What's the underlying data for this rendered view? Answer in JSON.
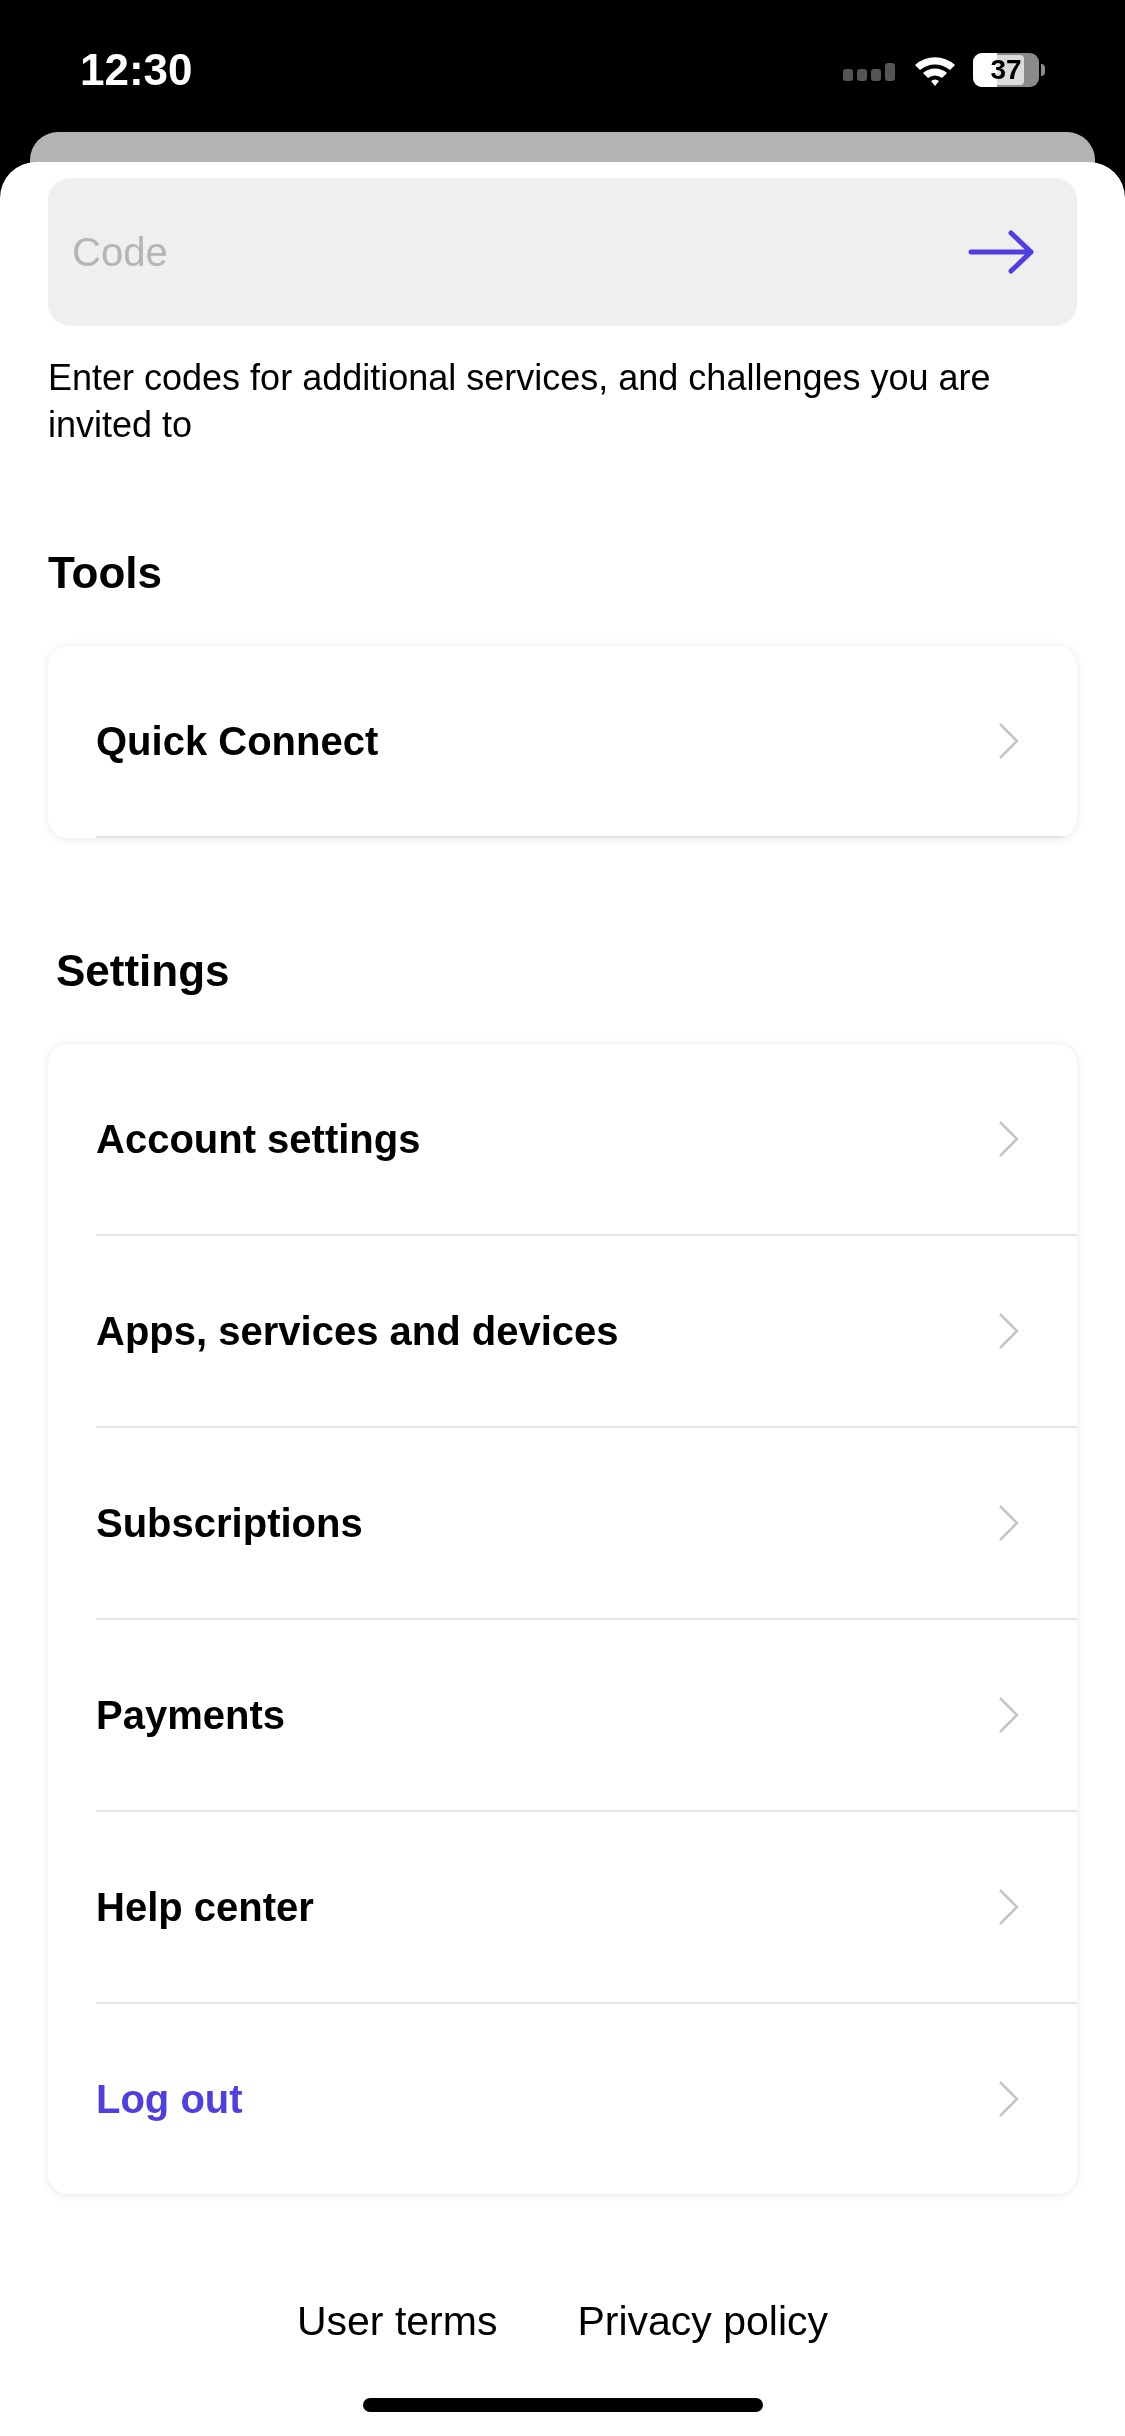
{
  "status_bar": {
    "time": "12:30",
    "battery": "37"
  },
  "code_field": {
    "placeholder": "Code"
  },
  "code_hint": "Enter codes for additional services, and challenges you are invited to",
  "sections": [
    {
      "title": "Tools",
      "items": [
        {
          "label": "Quick Connect",
          "kind": "normal"
        }
      ]
    },
    {
      "title": "Settings",
      "items": [
        {
          "label": "Account settings",
          "kind": "normal"
        },
        {
          "label": "Apps, services and devices",
          "kind": "normal"
        },
        {
          "label": "Subscriptions",
          "kind": "normal"
        },
        {
          "label": "Payments",
          "kind": "normal"
        },
        {
          "label": "Help center",
          "kind": "normal"
        },
        {
          "label": "Log out",
          "kind": "accent"
        }
      ]
    }
  ],
  "footer_links": [
    "User terms",
    "Privacy policy"
  ]
}
